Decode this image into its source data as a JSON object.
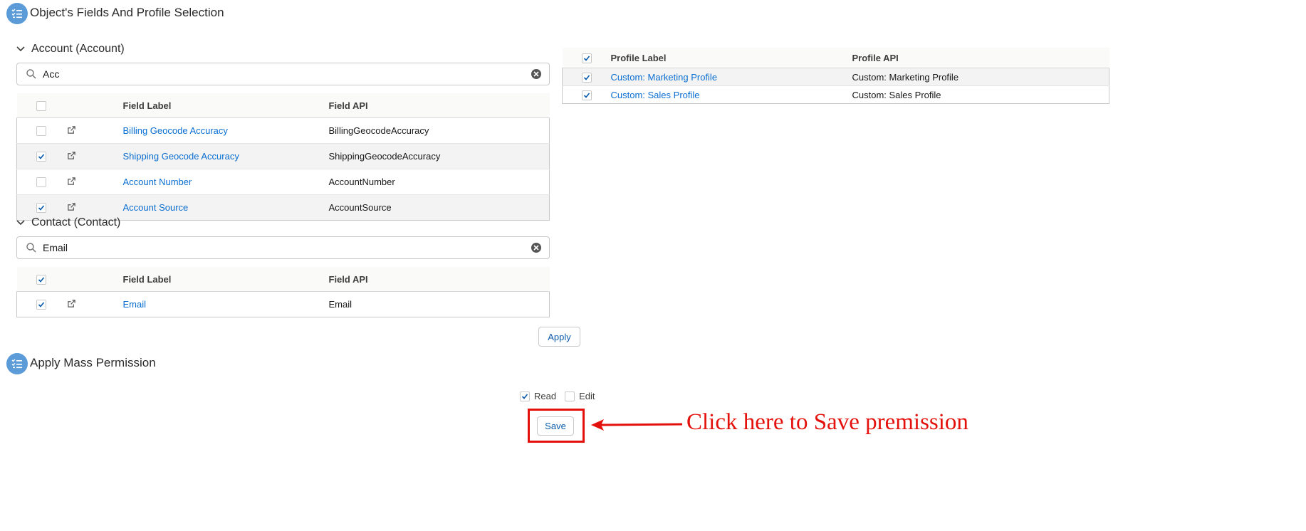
{
  "sections": {
    "fields_title": "Object's Fields And Profile Selection",
    "mass_title": "Apply Mass Permission"
  },
  "account": {
    "header": "Account (Account)",
    "search_value": "Acc",
    "col_label": "Field Label",
    "col_api": "Field API",
    "header_checked": false,
    "rows": [
      {
        "label": "Billing Geocode Accuracy",
        "api": "BillingGeocodeAccuracy",
        "checked": false
      },
      {
        "label": "Shipping Geocode Accuracy",
        "api": "ShippingGeocodeAccuracy",
        "checked": true
      },
      {
        "label": "Account Number",
        "api": "AccountNumber",
        "checked": false
      },
      {
        "label": "Account Source",
        "api": "AccountSource",
        "checked": true
      }
    ]
  },
  "contact": {
    "header": "Contact (Contact)",
    "search_value": "Email",
    "col_label": "Field Label",
    "col_api": "Field API",
    "header_checked": true,
    "rows": [
      {
        "label": "Email",
        "api": "Email",
        "checked": true
      }
    ]
  },
  "profiles": {
    "col_label": "Profile Label",
    "col_api": "Profile API",
    "header_checked": true,
    "rows": [
      {
        "label": "Custom: Marketing Profile",
        "api": "Custom: Marketing Profile",
        "checked": true
      },
      {
        "label": "Custom: Sales Profile",
        "api": "Custom: Sales Profile",
        "checked": true
      }
    ]
  },
  "apply_label": "Apply",
  "permissions": {
    "read_label": "Read",
    "read_checked": true,
    "edit_label": "Edit",
    "edit_checked": false
  },
  "save_label": "Save",
  "annotation": {
    "text": "Click here to Save premission",
    "color": "#e4100b"
  },
  "colors": {
    "link": "#0a6ed1",
    "icon_bg": "#5a9bd8",
    "check": "#0b5cab"
  }
}
